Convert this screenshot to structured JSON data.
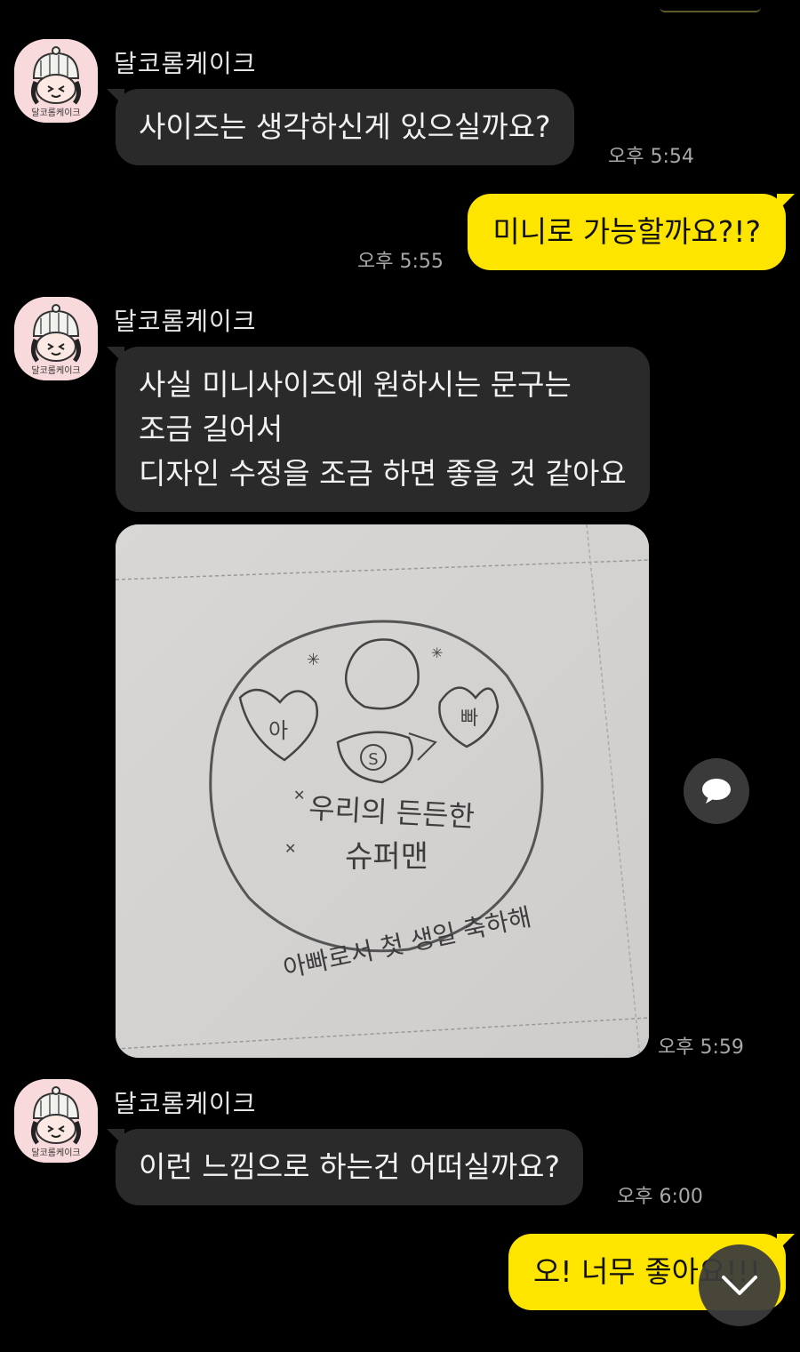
{
  "chat": {
    "sender_name": "달코롬케이크",
    "avatar_label": "달코롬케이크",
    "messages": [
      {
        "text": "사이즈는 생각하신게 있으실까요?",
        "time": "오후 5:54"
      },
      {
        "text": "미니로 가능할까요?!?",
        "time": "오후 5:55"
      },
      {
        "text": "사실 미니사이즈에 원하시는 문구는\n조금 길어서\n디자인 수정을 조금 하면 좋을 것 같아요"
      },
      {
        "photo_caption_1": "우리의 든든한",
        "photo_caption_2": "슈퍼맨",
        "photo_caption_3": "아빠로서 첫 생일 축하해",
        "left_heart": "아",
        "right_heart": "빠",
        "badge": "S",
        "time": "오후 5:59"
      },
      {
        "text": "이런 느낌으로 하는건 어떠실까요?",
        "time": "오후 6:00"
      },
      {
        "text": "오! 너무 좋아요!!!"
      }
    ]
  },
  "icons": {
    "reply": "chat-bubble-icon",
    "scroll": "chevron-down-icon"
  },
  "colors": {
    "background": "#000000",
    "incoming_bubble": "#2a2a2a",
    "outgoing_bubble": "#fee500"
  }
}
